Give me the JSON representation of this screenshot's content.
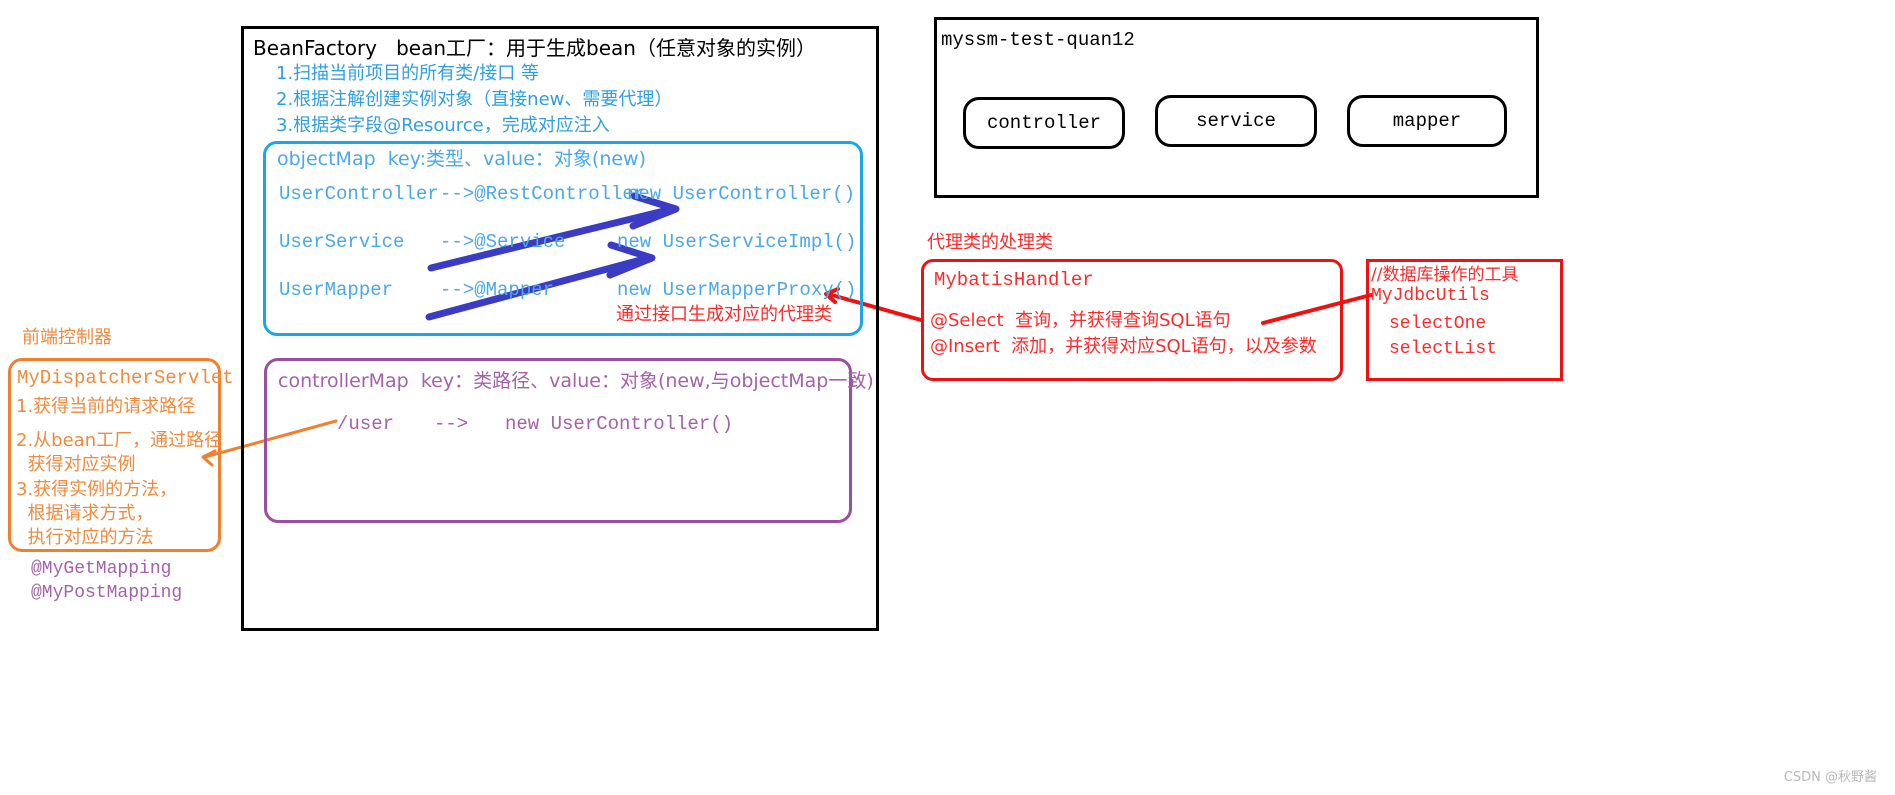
{
  "bean_factory": {
    "title": "BeanFactory   bean工厂：用于生成bean（任意对象的实例）",
    "steps": [
      "1.扫描当前项目的所有类/接口 等",
      "2.根据注解创建实例对象（直接new、需要代理）",
      "3.根据类字段@Resource，完成对应注入"
    ],
    "object_map": {
      "header": "objectMap  key:类型、value：对象(new)",
      "rows": [
        {
          "key": "UserController",
          "arrow": "-->@RestController",
          "value": "new UserController()"
        },
        {
          "key": "UserService",
          "arrow": "-->@Service",
          "value": "new UserServiceImpl()"
        },
        {
          "key": "UserMapper",
          "arrow": "-->@Mapper",
          "value": "new UserMapperProxy()"
        }
      ],
      "note": "通过接口生成对应的代理类"
    },
    "controller_map": {
      "header": "controllerMap  key：类路径、value：对象(new,与objectMap一致)",
      "rows": [
        {
          "path": "/user",
          "arrow": "-->",
          "value": "new UserController()"
        }
      ]
    }
  },
  "dispatcher": {
    "caption": "前端控制器",
    "title": "MyDispatcherServlet",
    "steps": [
      "1.获得当前的请求路径",
      "2.从bean工厂，通过路径",
      "  获得对应实例",
      "3.获得实例的方法，",
      "  根据请求方式，",
      "  执行对应的方法"
    ],
    "annotations": [
      "@MyGetMapping",
      "@MyPostMapping"
    ]
  },
  "project": {
    "name": "myssm-test-quan12",
    "packages": [
      "controller",
      "service",
      "mapper"
    ]
  },
  "mybatis": {
    "caption": "代理类的处理类",
    "title": "MybatisHandler",
    "lines": [
      "@Select  查询，并获得查询SQL语句",
      "@Insert  添加，并获得对应SQL语句，以及参数"
    ]
  },
  "jdbc": {
    "comment": "//数据库操作的工具",
    "title": "MyJdbcUtils",
    "methods": [
      "selectOne",
      "selectList"
    ]
  },
  "watermark": "CSDN @秋野酱",
  "colors": {
    "blue": "#4aa8e8",
    "purple": "#a561ab",
    "orange": "#f08a3c",
    "red": "#fb2b2b",
    "black": "#000000",
    "arrow_indigo": "#3b3bc4"
  }
}
